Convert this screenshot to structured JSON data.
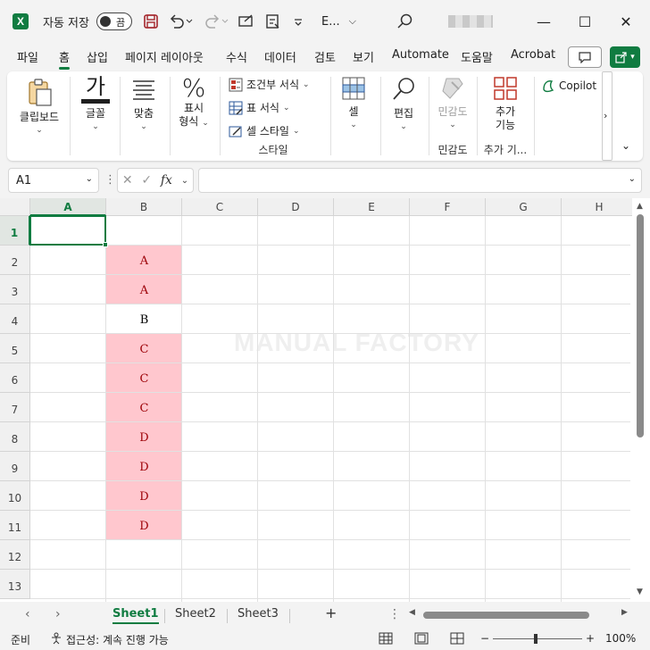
{
  "titlebar": {
    "autosave_label": "자동 저장",
    "autosave_state": "끔",
    "filename": "E...",
    "filename_chevron": "⌵",
    "minimize": "—",
    "maximize": "☐",
    "close": "✕"
  },
  "menu": {
    "tabs": [
      "파일",
      "홈",
      "삽입",
      "페이지 레이아웃",
      "수식",
      "데이터",
      "검토",
      "보기",
      "Automate",
      "도움말",
      "Acrobat"
    ],
    "active_tab": "홈"
  },
  "ribbon": {
    "clipboard": "클립보드",
    "font": "글꼴",
    "align": "맞춤",
    "number_line1": "표시",
    "number_line2": "형식",
    "conditional_format": "조건부 서식",
    "table_format": "표 서식",
    "cell_style": "셀 스타일",
    "styles_group": "스타일",
    "cells": "셀",
    "editing": "편집",
    "sensitivity": "민감도",
    "sensitivity_group": "민감도",
    "addins_line1": "추가",
    "addins_line2": "기능",
    "addins_group": "추가 기...",
    "copilot": "Copilot"
  },
  "formula_bar": {
    "name_box": "A1",
    "fx_label": "fx",
    "value": ""
  },
  "grid": {
    "columns": [
      "A",
      "B",
      "C",
      "D",
      "E",
      "F",
      "G",
      "H"
    ],
    "rows": [
      "1",
      "2",
      "3",
      "4",
      "5",
      "6",
      "7",
      "8",
      "9",
      "10",
      "11",
      "12",
      "13"
    ],
    "selected_cell": "A1",
    "column_b_values": [
      "",
      "A",
      "A",
      "B",
      "C",
      "C",
      "C",
      "D",
      "D",
      "D",
      "D",
      "",
      ""
    ],
    "highlight_fill": "#ffc7ce",
    "highlight_text": "#9c0006"
  },
  "watermark": "MANUAL FACTORY",
  "sheets": {
    "tabs": [
      "Sheet1",
      "Sheet2",
      "Sheet3"
    ],
    "active": "Sheet1",
    "add": "+"
  },
  "status": {
    "ready": "준비",
    "accessibility": "접근성: 계속 진행 가능",
    "zoom": "100%"
  },
  "colors": {
    "accent": "#107c41"
  }
}
